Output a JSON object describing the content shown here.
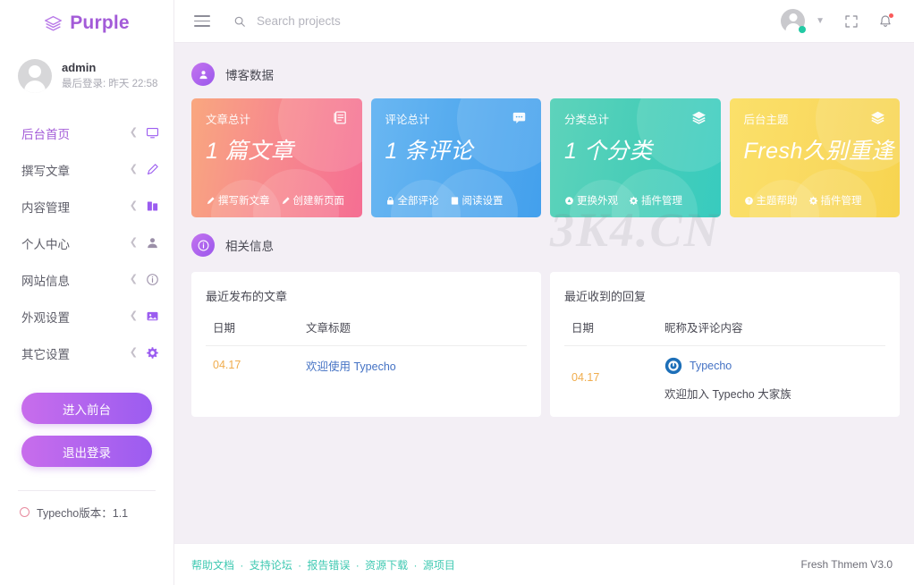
{
  "brand": {
    "name": "Purple",
    "icon": "layers-icon"
  },
  "profile": {
    "name": "admin",
    "last_login": "最后登录: 昨天 22:58"
  },
  "sidebar": {
    "items": [
      {
        "label": "后台首页",
        "icon": "monitor-icon",
        "active": true
      },
      {
        "label": "撰写文章",
        "icon": "pencil-icon",
        "active": false
      },
      {
        "label": "内容管理",
        "icon": "book-icon",
        "active": false
      },
      {
        "label": "个人中心",
        "icon": "user-icon",
        "active": false
      },
      {
        "label": "网站信息",
        "icon": "info-icon",
        "active": false
      },
      {
        "label": "外观设置",
        "icon": "image-icon",
        "active": false
      },
      {
        "label": "其它设置",
        "icon": "gear-icon",
        "active": false
      }
    ],
    "buttons": {
      "front": "进入前台",
      "logout": "退出登录"
    },
    "version": "Typecho版本：1.1"
  },
  "topbar": {
    "menu_icon": "hamburger-icon",
    "search": {
      "placeholder": "Search projects",
      "value": "",
      "icon": "search-icon"
    },
    "avatar_icon": "user-avatar",
    "chevron_icon": "chevron-down-icon",
    "fullscreen_icon": "fullscreen-icon",
    "bell_icon": "bell-icon"
  },
  "sections": {
    "blog_data": {
      "title": "博客数据",
      "icon": "user-circle-icon"
    },
    "related_info": {
      "title": "相关信息",
      "icon": "info-circle-icon"
    }
  },
  "cards": [
    {
      "label": "文章总计",
      "value": "1 篇文章",
      "icon": "article-icon",
      "links": [
        {
          "label": "撰写新文章",
          "icon": "pencil-icon"
        },
        {
          "label": "创建新页面",
          "icon": "pencil-icon"
        }
      ]
    },
    {
      "label": "评论总计",
      "value": "1 条评论",
      "icon": "comment-icon",
      "links": [
        {
          "label": "全部评论",
          "icon": "lock-icon"
        },
        {
          "label": "阅读设置",
          "icon": "book-icon"
        }
      ]
    },
    {
      "label": "分类总计",
      "value": "1 个分类",
      "icon": "layers-icon",
      "links": [
        {
          "label": "更换外观",
          "icon": "brush-icon"
        },
        {
          "label": "插件管理",
          "icon": "gear-icon"
        }
      ]
    },
    {
      "label": "后台主题",
      "value": "Fresh久别重逢",
      "icon": "layers-icon",
      "links": [
        {
          "label": "主题帮助",
          "icon": "question-icon"
        },
        {
          "label": "插件管理",
          "icon": "gear-icon"
        }
      ]
    }
  ],
  "recent_posts": {
    "title": "最近发布的文章",
    "columns": [
      "日期",
      "文章标题"
    ],
    "rows": [
      {
        "date": "04.17",
        "title": "欢迎使用 Typecho"
      }
    ]
  },
  "recent_comments": {
    "title": "最近收到的回复",
    "columns": [
      "日期",
      "昵称及评论内容"
    ],
    "rows": [
      {
        "date": "04.17",
        "author": "Typecho",
        "text": "欢迎加入 Typecho 大家族"
      }
    ]
  },
  "watermark": "3K4.CN",
  "footer": {
    "links": [
      "帮助文档",
      "支持论坛",
      "报告错误",
      "资源下载",
      "源项目"
    ],
    "separator": "·",
    "right": "Fresh Thmem V3.0"
  },
  "colors": {
    "brand_purple": "#a35bd8",
    "card_pink": "#f56e93",
    "card_blue": "#43a0ed",
    "card_green": "#38cbbf",
    "card_yellow": "#f7d44f",
    "footer_teal": "#3fc9b2",
    "date_amber": "#f0ad4e",
    "link_blue": "#4472c4",
    "online_green": "#22c9a4",
    "alert_red": "#fa5a5a"
  }
}
